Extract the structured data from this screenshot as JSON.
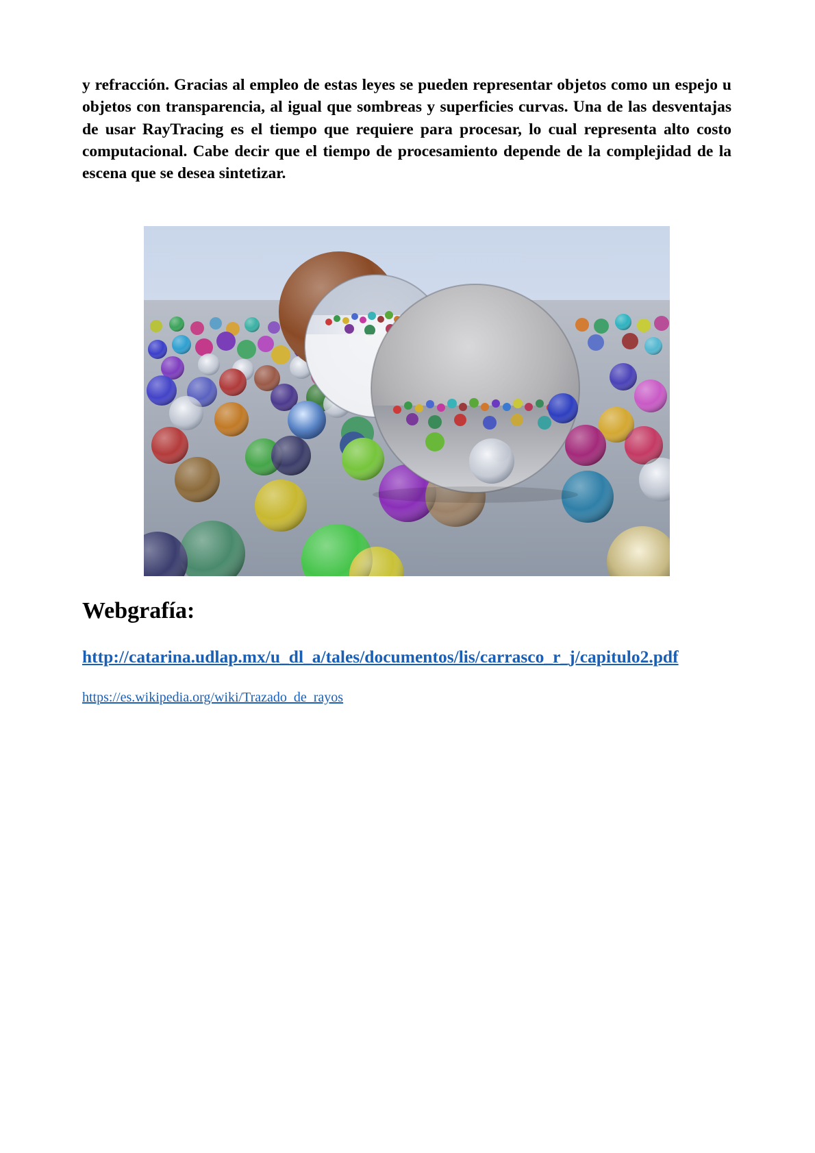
{
  "body": {
    "paragraph": "y refracción. Gracias al empleo de estas leyes se pueden representar objetos como un espejo u objetos con transparencia, al igual que sombreas y superficies curvas. Una de las desventajas de usar RayTracing es el tiempo que requiere para procesar, lo cual representa alto costo computacional. Cabe decir que el tiempo de procesamiento depende de la complejidad de la escena que se desea sintetizar."
  },
  "figure": {
    "colors": {
      "sky_top": "#c9d6ea",
      "floor": "#8f98a6",
      "mirror_sphere": "#b9b9bc",
      "glass_sphere": "#e9ecf2",
      "brown_sphere": "#8a4a26"
    }
  },
  "webgrafia": {
    "heading": "Webgrafía:",
    "links": [
      "http://catarina.udlap.mx/u_dl_a/tales/documentos/lis/carrasco_r_j/capitulo2.pdf",
      "https://es.wikipedia.org/wiki/Trazado_de_rayos"
    ]
  },
  "colors": {
    "link": "#1a5fb4",
    "text": "#000000",
    "background": "#ffffff"
  }
}
